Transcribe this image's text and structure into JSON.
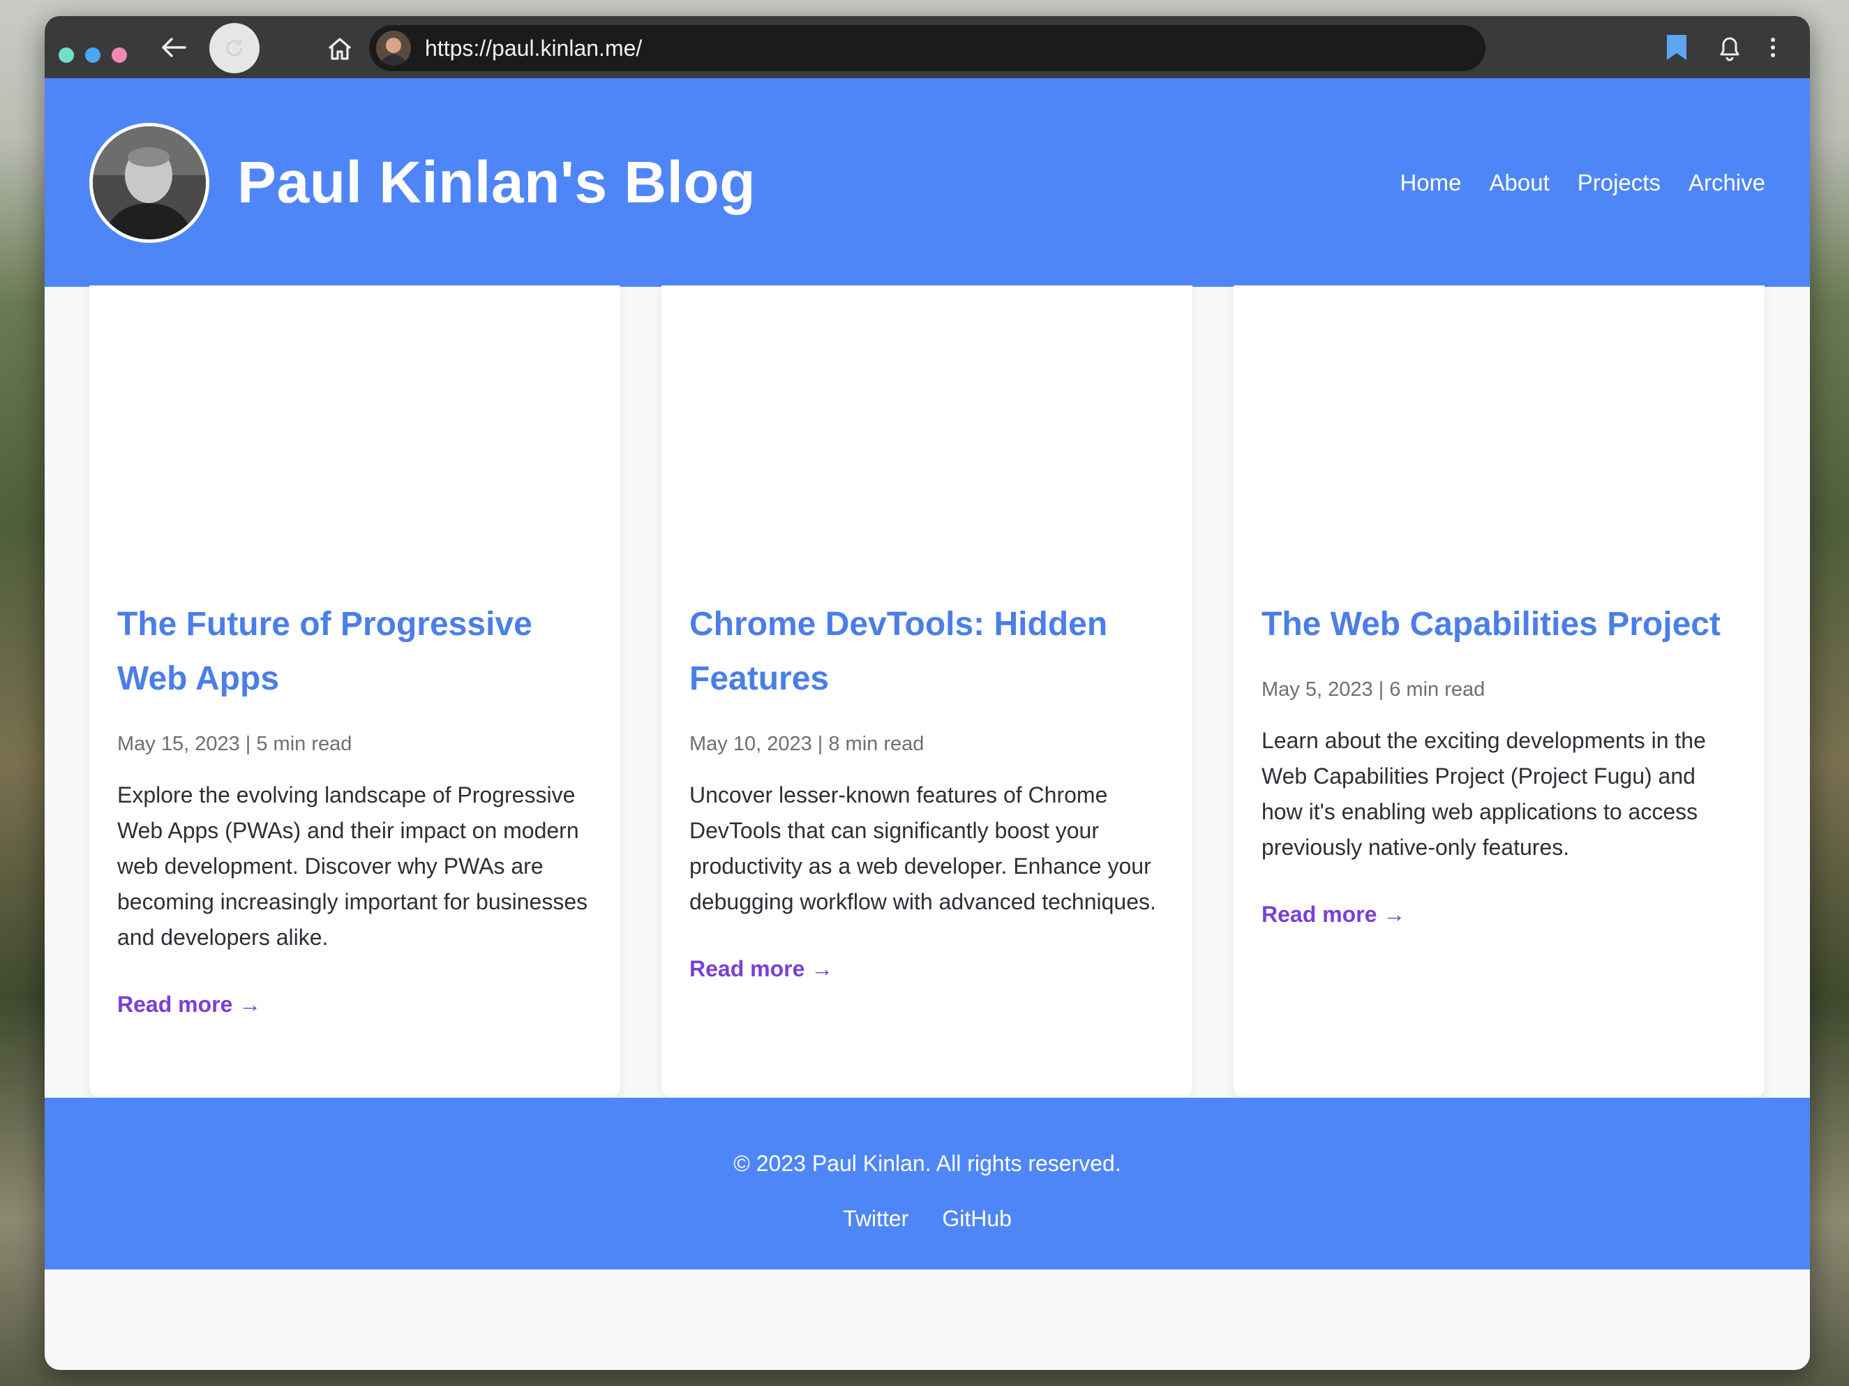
{
  "browser": {
    "url": "https://paul.kinlan.me/",
    "traffic_colors": [
      "#6ee0c7",
      "#4aa8f2",
      "#f08ab5"
    ]
  },
  "site": {
    "title": "Paul Kinlan's Blog",
    "nav": [
      {
        "label": "Home"
      },
      {
        "label": "About"
      },
      {
        "label": "Projects"
      },
      {
        "label": "Archive"
      }
    ]
  },
  "posts": [
    {
      "title": "The Future of Progressive Web Apps",
      "meta": "May 15, 2023 | 5 min read",
      "excerpt": "Explore the evolving landscape of Progressive Web Apps (PWAs) and their impact on modern web development. Discover why PWAs are becoming increasingly important for businesses and developers alike.",
      "read_more": "Read more →"
    },
    {
      "title": "Chrome DevTools: Hidden Features",
      "meta": "May 10, 2023 | 8 min read",
      "excerpt": "Uncover lesser-known features of Chrome DevTools that can significantly boost your productivity as a web developer. Enhance your debugging workflow with advanced techniques.",
      "read_more": "Read more →"
    },
    {
      "title": "The Web Capabilities Project",
      "meta": "May 5, 2023 | 6 min read",
      "excerpt": "Learn about the exciting developments in the Web Capabilities Project (Project Fugu) and how it's enabling web applications to access previously native-only features.",
      "read_more": "Read more →"
    }
  ],
  "footer": {
    "copyright": "© 2023 Paul Kinlan. All rights reserved.",
    "links": [
      {
        "label": "Twitter"
      },
      {
        "label": "GitHub"
      }
    ]
  },
  "colors": {
    "brand_blue": "#4f86f7",
    "title_blue": "#4a7ee8",
    "link_purple": "#7a3fd6"
  },
  "icons": {
    "back": "arrow-left-icon",
    "reload": "reload-icon",
    "home": "home-icon",
    "bookmark": "bookmark-icon",
    "notifications": "bell-icon",
    "menu": "kebab-menu-icon"
  }
}
